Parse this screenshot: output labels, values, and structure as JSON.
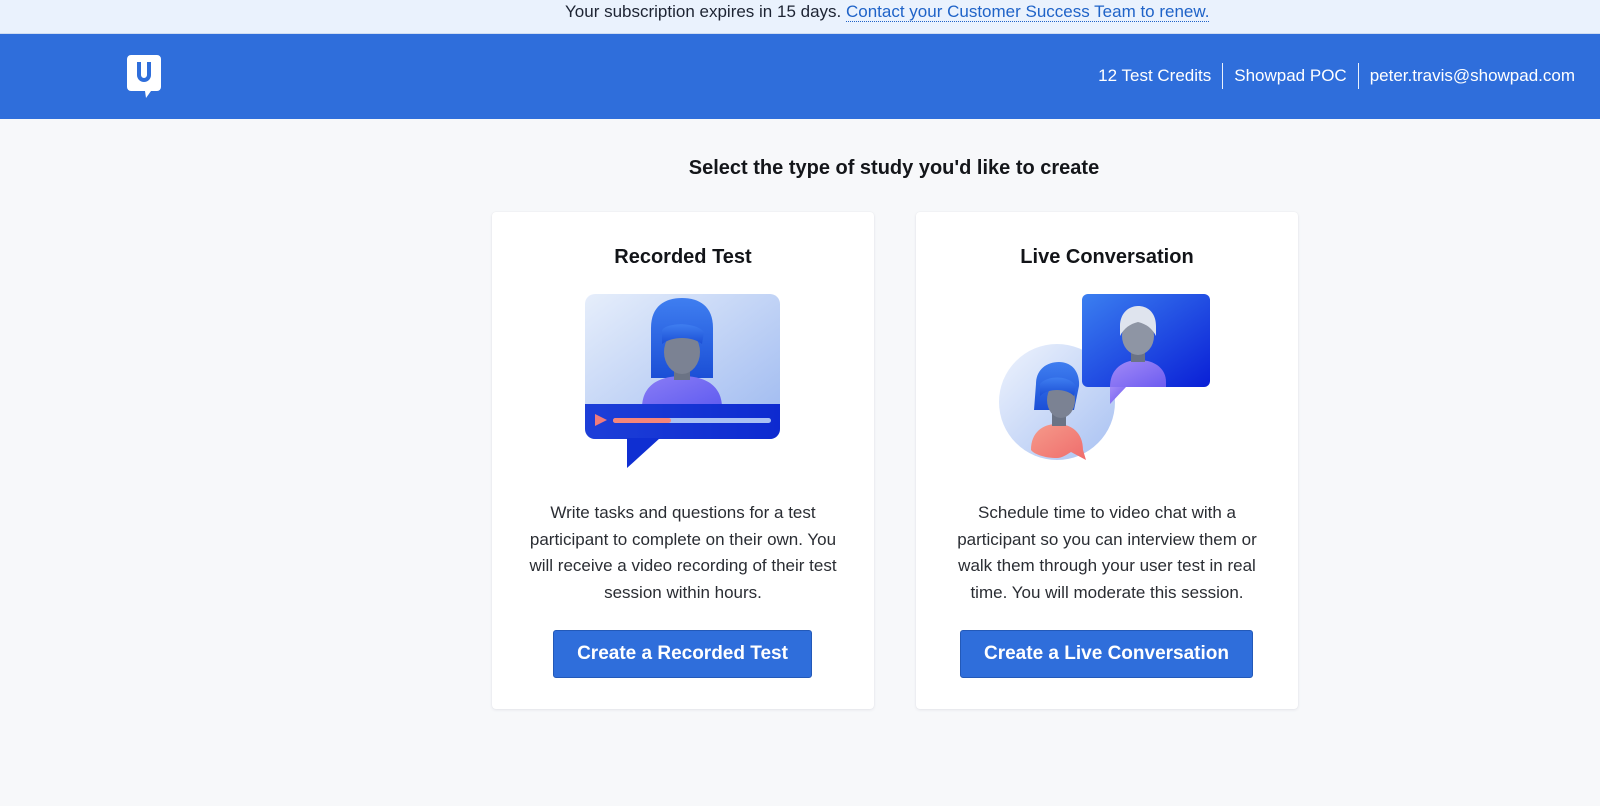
{
  "notice": {
    "text": "Your subscription expires in 15 days.",
    "link": "Contact your Customer Success Team to renew."
  },
  "header": {
    "logo_icon": "usertesting-logo-icon",
    "credits": "12 Test Credits",
    "account": "Showpad POC",
    "email": "peter.travis@showpad.com"
  },
  "main": {
    "title": "Select the type of study you'd like to create",
    "cards": [
      {
        "title": "Recorded Test",
        "illustration": "recorded-video-illustration",
        "description": "Write tasks and questions for a test participant to complete on their own. You will receive a video recording of their test session within hours.",
        "button": "Create a Recorded Test"
      },
      {
        "title": "Live Conversation",
        "illustration": "live-chat-illustration",
        "description": "Schedule time to video chat with a participant so you can interview them or walk them through your user test in real time. You will moderate this session.",
        "button": "Create a Live Conversation"
      }
    ]
  },
  "colors": {
    "brand_blue": "#2f6edb",
    "notice_bg": "#eaf2fd",
    "page_bg": "#f7f8fa"
  }
}
